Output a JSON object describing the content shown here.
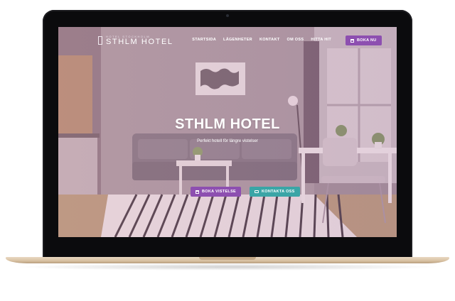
{
  "site": {
    "logo_sub": "HOTEL STOCKHOLM",
    "logo_text": "STHLM HOTEL"
  },
  "nav": {
    "items": [
      {
        "label": "STARTSIDA"
      },
      {
        "label": "LÄGENHETER"
      },
      {
        "label": "KONTAKT"
      },
      {
        "label": "OM OSS"
      },
      {
        "label": "HITTA HIT"
      }
    ],
    "cta_label": "BOKA NU"
  },
  "hero": {
    "title": "STHLM HOTEL",
    "subtitle": "Perfekt hotell för längre vistelser",
    "primary_button": "BOKA VISTELSE",
    "secondary_button": "KONTAKTA OSS"
  },
  "colors": {
    "accent_purple": "#8d4fb0",
    "accent_teal": "#3aa5a6",
    "laptop_gold": "#d8c1a2"
  },
  "icons": {
    "nav_cta_icon": "calendar-icon",
    "primary_button_icon": "calendar-icon",
    "secondary_button_icon": "chat-icon"
  }
}
